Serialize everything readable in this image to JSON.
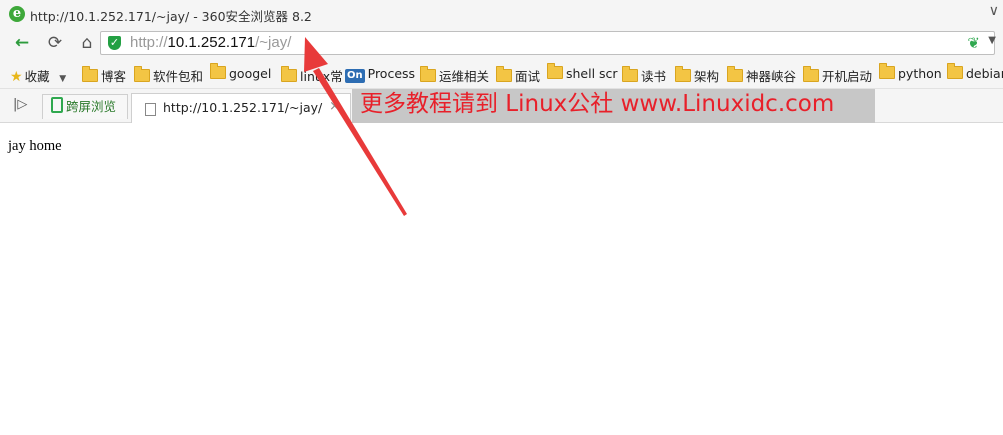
{
  "window": {
    "title": "http://10.1.252.171/~jay/ - 360安全浏览器 8.2",
    "close": "∨"
  },
  "address": {
    "scheme": "http://",
    "host": "10.1.252.171",
    "path": "/~jay/"
  },
  "bookmarks": [
    {
      "label": "收藏",
      "icon": "star-icon"
    },
    {
      "label": "博客",
      "icon": "folder-icon"
    },
    {
      "label": "软件包和",
      "icon": "folder-icon"
    },
    {
      "label": "googel",
      "icon": "folder-icon"
    },
    {
      "label": "linux常",
      "icon": "folder-icon"
    },
    {
      "label": "Process",
      "icon": "on-icon",
      "icon_text": "On"
    },
    {
      "label": "运维相关",
      "icon": "folder-icon"
    },
    {
      "label": "面试",
      "icon": "folder-icon"
    },
    {
      "label": "shell scr",
      "icon": "folder-icon"
    },
    {
      "label": "读书",
      "icon": "folder-icon"
    },
    {
      "label": "架构",
      "icon": "folder-icon"
    },
    {
      "label": "神器峡谷",
      "icon": "folder-icon"
    },
    {
      "label": "开机启动",
      "icon": "folder-icon"
    },
    {
      "label": "python",
      "icon": "folder-icon"
    },
    {
      "label": "debian",
      "icon": "folder-icon"
    }
  ],
  "tabs": {
    "cross_browse": "跨屏浏览",
    "active_title": "http://10.1.252.171/~jay/",
    "close": "×"
  },
  "watermark": "更多教程请到 Linux公社 www.Linuxidc.com",
  "page": {
    "text": "jay home"
  },
  "colors": {
    "accent_green": "#2fa84f",
    "annotation_red": "#e8202a",
    "folder_yellow": "#f3c544"
  }
}
